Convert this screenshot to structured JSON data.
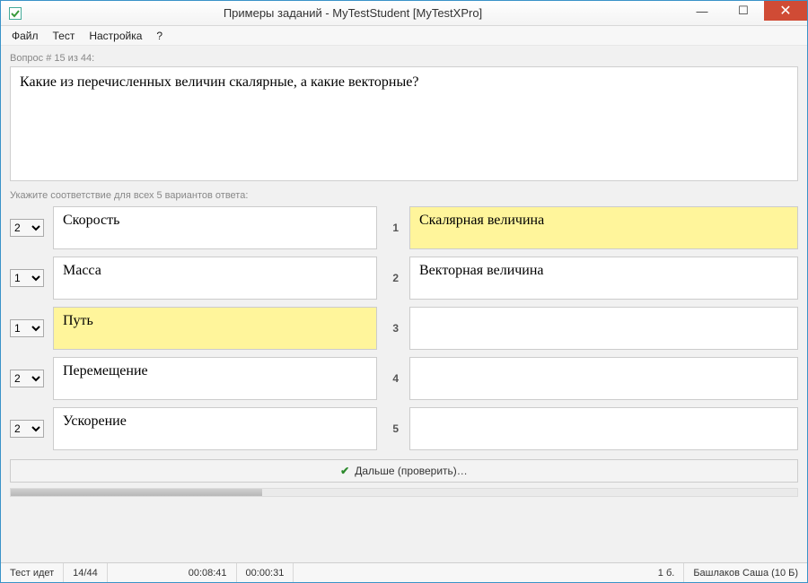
{
  "title": "Примеры заданий - MyTestStudent [MyTestXPro]",
  "menu": {
    "file": "Файл",
    "test": "Тест",
    "settings": "Настройка",
    "help": "?"
  },
  "q_counter": "Вопрос # 15 из 44:",
  "question": "Какие из перечисленных величин скалярные, а какие векторные?",
  "instruction": "Укажите соответствие для всех 5 вариантов ответа:",
  "left": [
    {
      "sel": "2",
      "text": "Скорость",
      "hl": false
    },
    {
      "sel": "1",
      "text": "Масса",
      "hl": false
    },
    {
      "sel": "1",
      "text": "Путь",
      "hl": true
    },
    {
      "sel": "2",
      "text": "Перемещение",
      "hl": false
    },
    {
      "sel": "2",
      "text": "Ускорение",
      "hl": false
    }
  ],
  "right": [
    {
      "n": "1",
      "text": "Скалярная величина",
      "hl": true
    },
    {
      "n": "2",
      "text": "Векторная величина",
      "hl": false
    },
    {
      "n": "3",
      "text": "",
      "hl": false
    },
    {
      "n": "4",
      "text": "",
      "hl": false
    },
    {
      "n": "5",
      "text": "",
      "hl": false
    }
  ],
  "proceed": "Дальше (проверить)…",
  "progress_pct": 32,
  "status": {
    "state": "Тест идет",
    "pos": "14/44",
    "t1": "00:08:41",
    "t2": "00:00:31",
    "points": "1 б.",
    "user": "Башлаков Саша (10 Б)"
  }
}
